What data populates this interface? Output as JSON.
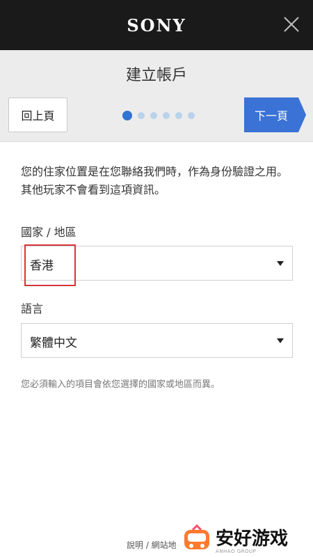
{
  "topbar": {
    "brand": "SONY",
    "close_icon": "close-icon"
  },
  "header": {
    "title": "建立帳戶",
    "back_label": "回上頁",
    "next_label": "下一頁",
    "steps_total": 6,
    "steps_current": 1,
    "colors": {
      "next_bg": "#3a72d6",
      "dot_active": "#2f74d0",
      "dot_inactive": "#b9d3ea"
    }
  },
  "content": {
    "info": "您的住家位置是在您聯絡我們時，作為身份驗證之用。其他玩家不會看到這項資訊。",
    "country_label": "國家 / 地區",
    "country_value": "香港",
    "language_label": "語言",
    "language_value": "繁體中文",
    "note": "您必須輸入的項目會依您選擇的國家或地區而異。"
  },
  "footer": {
    "links": "說明 / 網站地"
  },
  "watermark": {
    "text": "安好游戏",
    "sub": "ANHAO GROUP"
  }
}
